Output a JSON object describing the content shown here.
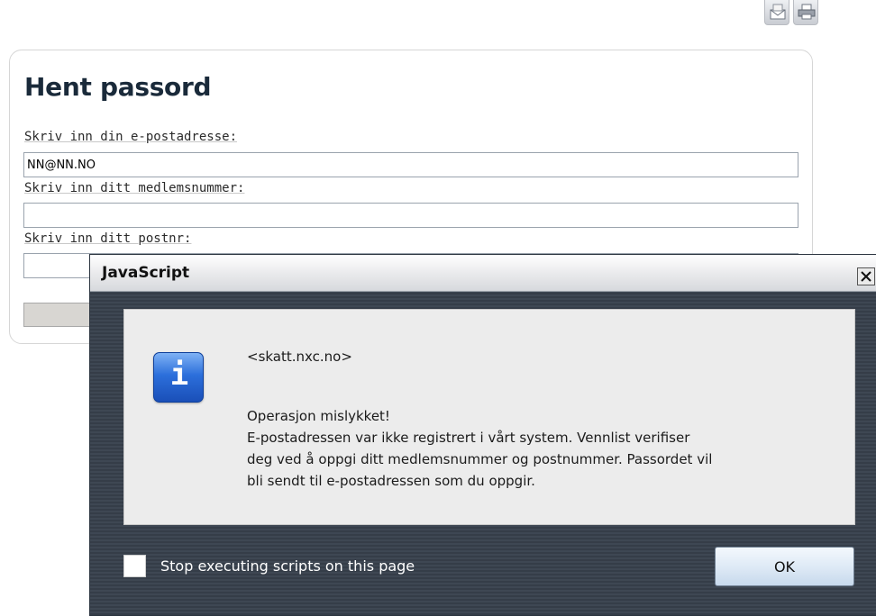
{
  "toolbar": {
    "icons": [
      "mail-icon",
      "print-icon"
    ]
  },
  "form": {
    "title": "Hent passord",
    "email_label": "Skriv inn din e-postadresse:",
    "email_value": "NN@NN.NO",
    "member_label": "Skriv inn ditt medlemsnummer:",
    "member_value": "",
    "postal_label": "Skriv inn ditt postnr:",
    "postal_value": ""
  },
  "dialog": {
    "title": "JavaScript",
    "origin": "<skatt.nxc.no>",
    "icon": "info-icon",
    "icon_glyph": "i",
    "message_lines": [
      "Operasjon mislykket!",
      "E-postadressen var ikke registrert i vårt system. Vennlist verifiser",
      "deg ved å oppgi ditt medlemsnummer og postnummer. Passordet vil",
      "bli sendt til e-postadressen som du oppgir."
    ],
    "checkbox_label": "Stop executing scripts on this page",
    "checkbox_checked": false,
    "ok_label": "OK"
  },
  "colors": {
    "title_text": "#1a2a3a",
    "dialog_bg": "#3e4753",
    "info_icon_blue": "#2c6fdb"
  }
}
